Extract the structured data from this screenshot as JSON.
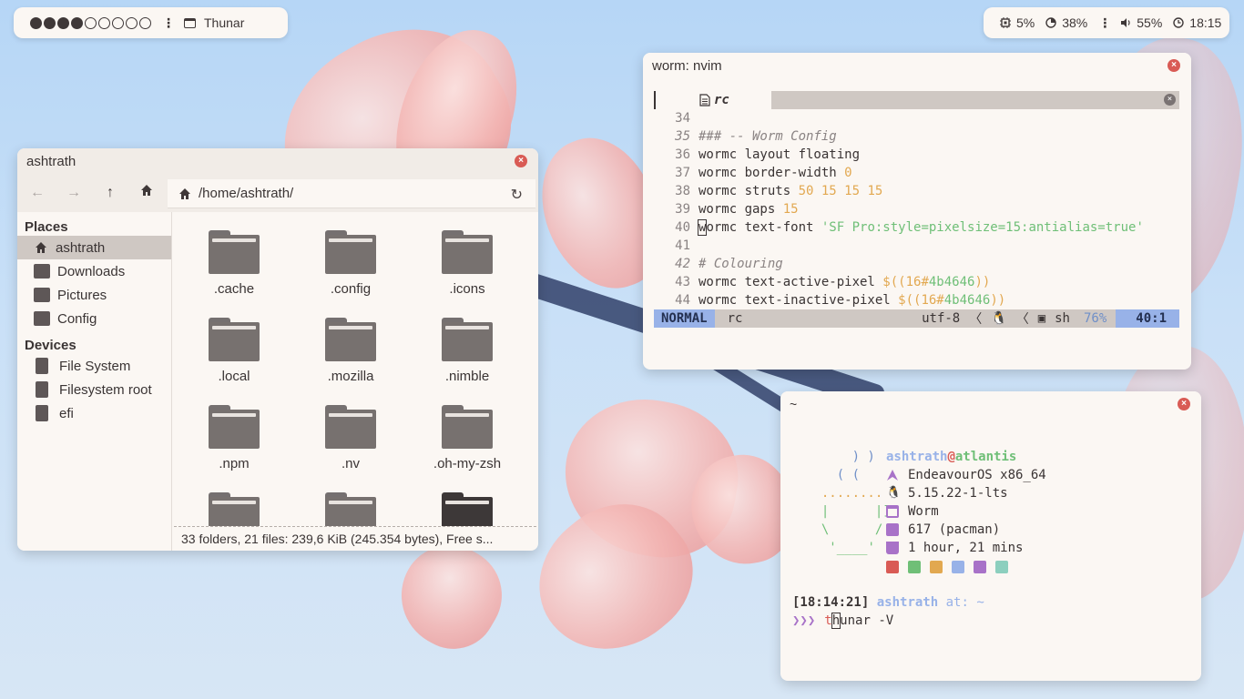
{
  "topbar_left": {
    "workspaces": [
      true,
      true,
      true,
      true,
      false,
      false,
      false,
      false,
      false
    ],
    "active_window": "Thunar"
  },
  "topbar_right": {
    "cpu": "5%",
    "memory": "38%",
    "volume": "55%",
    "clock": "18:15"
  },
  "thunar": {
    "title": "ashtrath",
    "path": "/home/ashtrath/",
    "places_header": "Places",
    "places": [
      "ashtrath",
      "Downloads",
      "Pictures",
      "Config"
    ],
    "devices_header": "Devices",
    "devices": [
      "File System",
      "Filesystem root",
      "efi"
    ],
    "folders": [
      ".cache",
      ".config",
      ".icons",
      ".local",
      ".mozilla",
      ".nimble",
      ".npm",
      ".nv",
      ".oh-my-zsh",
      "",
      "",
      ""
    ],
    "status": "33 folders, 21 files: 239,6 KiB (245.354 bytes), Free s..."
  },
  "nvim": {
    "title": "worm: nvim",
    "tab": "rc",
    "lines": [
      {
        "n": "34",
        "text": ""
      },
      {
        "n": "35",
        "text": "### -- Worm Config"
      },
      {
        "n": "36",
        "text": "wormc layout floating"
      },
      {
        "n": "37",
        "text": "wormc border-width 0"
      },
      {
        "n": "38",
        "text": "wormc struts 50 15 15 15"
      },
      {
        "n": "39",
        "text": "wormc gaps 15"
      },
      {
        "n": "40",
        "text": "wormc text-font 'SF Pro:style=pixelsize=15:antialias=true'"
      },
      {
        "n": "41",
        "text": ""
      },
      {
        "n": "42",
        "text": "# Colouring"
      },
      {
        "n": "43",
        "text": "wormc text-active-pixel $((16#4b4646))"
      },
      {
        "n": "44",
        "text": "wormc text-inactive-pixel $((16#4b4646))"
      }
    ],
    "status": {
      "mode": "NORMAL",
      "file": "rc",
      "encoding": "utf-8",
      "filetype": "sh",
      "percent": "76%",
      "position": "40:1"
    }
  },
  "terminal": {
    "title": "~",
    "user": "ashtrath",
    "at": "@",
    "host": "atlantis",
    "os": "EndeavourOS x86_64",
    "kernel": "5.15.22-1-lts",
    "wm": "Worm",
    "packages": "617 (pacman)",
    "uptime": "1 hour, 21 mins",
    "palette": [
      "#d95b55",
      "#6fbf77",
      "#e2a850",
      "#98b2e8",
      "#a872c8",
      "#8ccfbe"
    ],
    "prompt_time": "[18:14:21]",
    "prompt_user": "ashtrath",
    "prompt_at": "at:",
    "prompt_dir": "~",
    "prompt_symbol": "❯❯❯",
    "command_t": "t",
    "command_h": "h",
    "command_rest": "unar -V"
  }
}
